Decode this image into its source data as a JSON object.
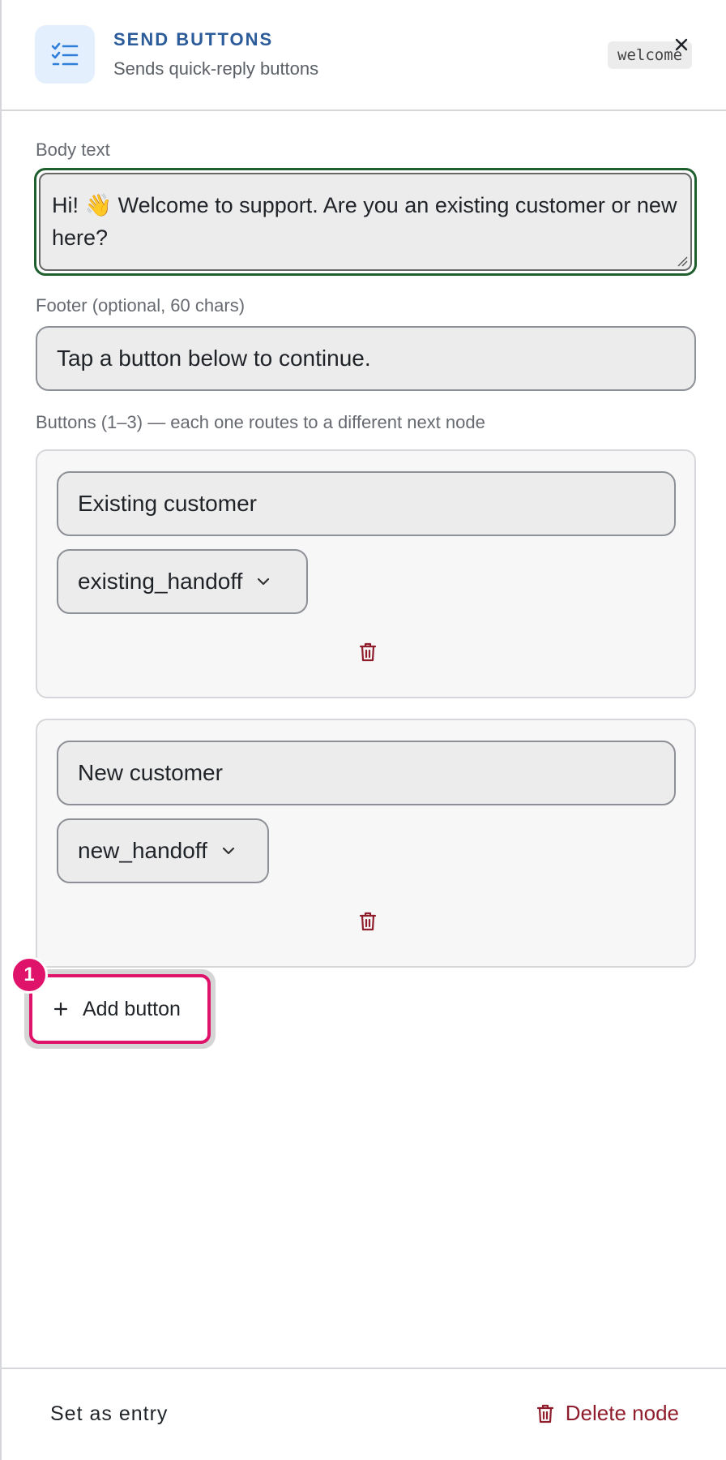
{
  "header": {
    "type_label": "SEND BUTTONS",
    "subtitle": "Sends quick-reply buttons",
    "node_id": "welcome",
    "icon": "checklist-icon",
    "close_icon": "close-icon"
  },
  "body": {
    "label": "Body text",
    "value": "Hi! 👋 Welcome to support. Are you an existing customer or new here?"
  },
  "footer_field": {
    "label": "Footer (optional, 60 chars)",
    "value": "Tap a button below to continue."
  },
  "buttons": {
    "label": "Buttons (1–3) — each one routes to a different next node",
    "items": [
      {
        "title": "Existing customer",
        "target": "existing_handoff"
      },
      {
        "title": "New customer",
        "target": "new_handoff"
      }
    ],
    "add_label": "Add button"
  },
  "annotation": {
    "badge": "1"
  },
  "actions": {
    "set_entry": "Set as entry",
    "delete_node": "Delete node"
  },
  "colors": {
    "accent_blue": "#2c5c9a",
    "focus_green": "#1f5e2d",
    "highlight_pink": "#e0136b",
    "danger_red": "#8f1d2c"
  }
}
